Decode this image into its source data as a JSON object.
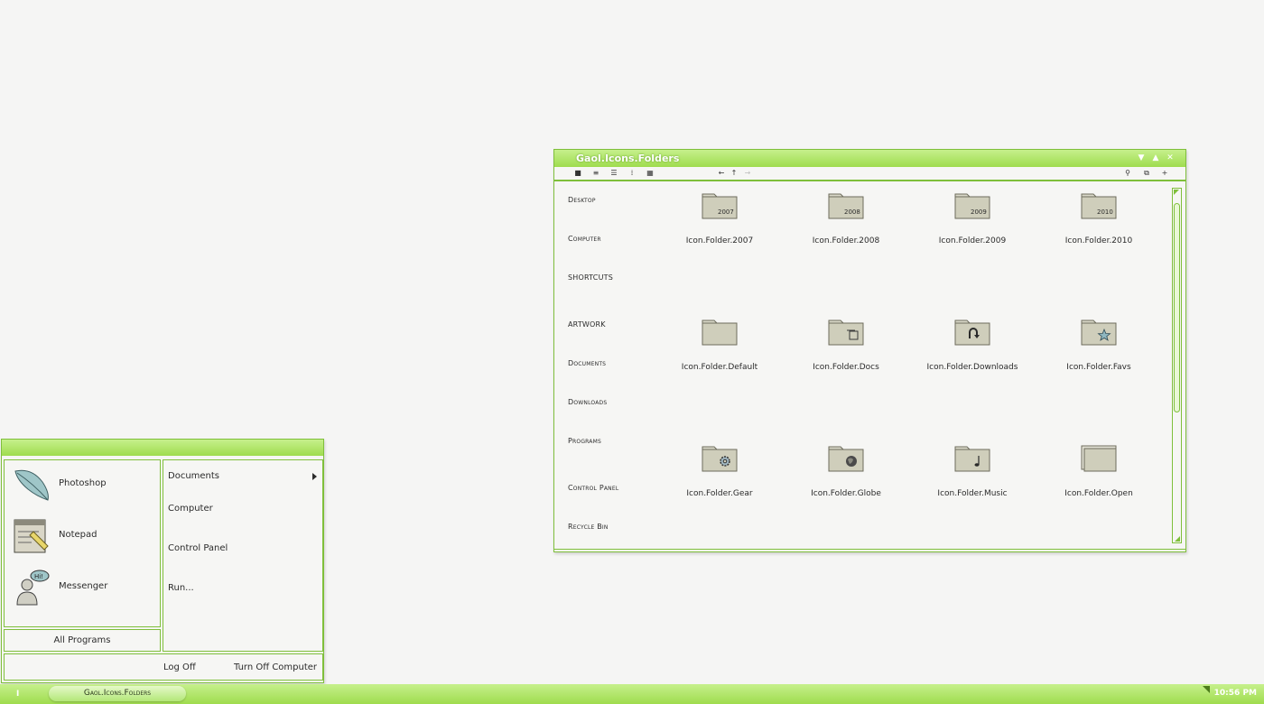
{
  "explorer": {
    "title": "Gaol.Icons.Folders",
    "nav": [
      "Desktop",
      "Computer",
      "SHORTCUTS",
      "ARTWORK",
      "Documents",
      "Downloads",
      "Programs",
      "Control Panel",
      "Recycle Bin"
    ],
    "folders": [
      {
        "label": "Icon.Folder.2007",
        "badge": "2007"
      },
      {
        "label": "Icon.Folder.2008",
        "badge": "2008"
      },
      {
        "label": "Icon.Folder.2009",
        "badge": "2009"
      },
      {
        "label": "Icon.Folder.2010",
        "badge": "2010"
      },
      {
        "label": "Icon.Folder.Default",
        "badge": ""
      },
      {
        "label": "Icon.Folder.Docs",
        "badge": ""
      },
      {
        "label": "Icon.Folder.Downloads",
        "badge": ""
      },
      {
        "label": "Icon.Folder.Favs",
        "badge": ""
      },
      {
        "label": "Icon.Folder.Gear",
        "badge": ""
      },
      {
        "label": "Icon.Folder.Globe",
        "badge": ""
      },
      {
        "label": "Icon.Folder.Music",
        "badge": ""
      },
      {
        "label": "Icon.Folder.Open",
        "badge": ""
      }
    ],
    "icons": {
      "minimize": "chevron-down-icon",
      "maximize": "chevron-up-icon",
      "close": "close-icon"
    }
  },
  "startmenu": {
    "pinned": [
      {
        "label": "Photoshop",
        "icon": "feather-icon"
      },
      {
        "label": "Notepad",
        "icon": "notepad-icon"
      },
      {
        "label": "Messenger",
        "icon": "messenger-icon"
      }
    ],
    "all_programs": "All Programs",
    "places": [
      "Documents",
      "Computer",
      "Control Panel",
      "Run..."
    ],
    "log_off": "Log Off",
    "turn_off": "Turn Off Computer"
  },
  "taskbar": {
    "start_label": "I",
    "task_label": "Gaol.Icons.Folders",
    "clock": "10:56 PM"
  },
  "colors": {
    "accent": "#9fdc4e",
    "border": "#7fbf3b"
  }
}
